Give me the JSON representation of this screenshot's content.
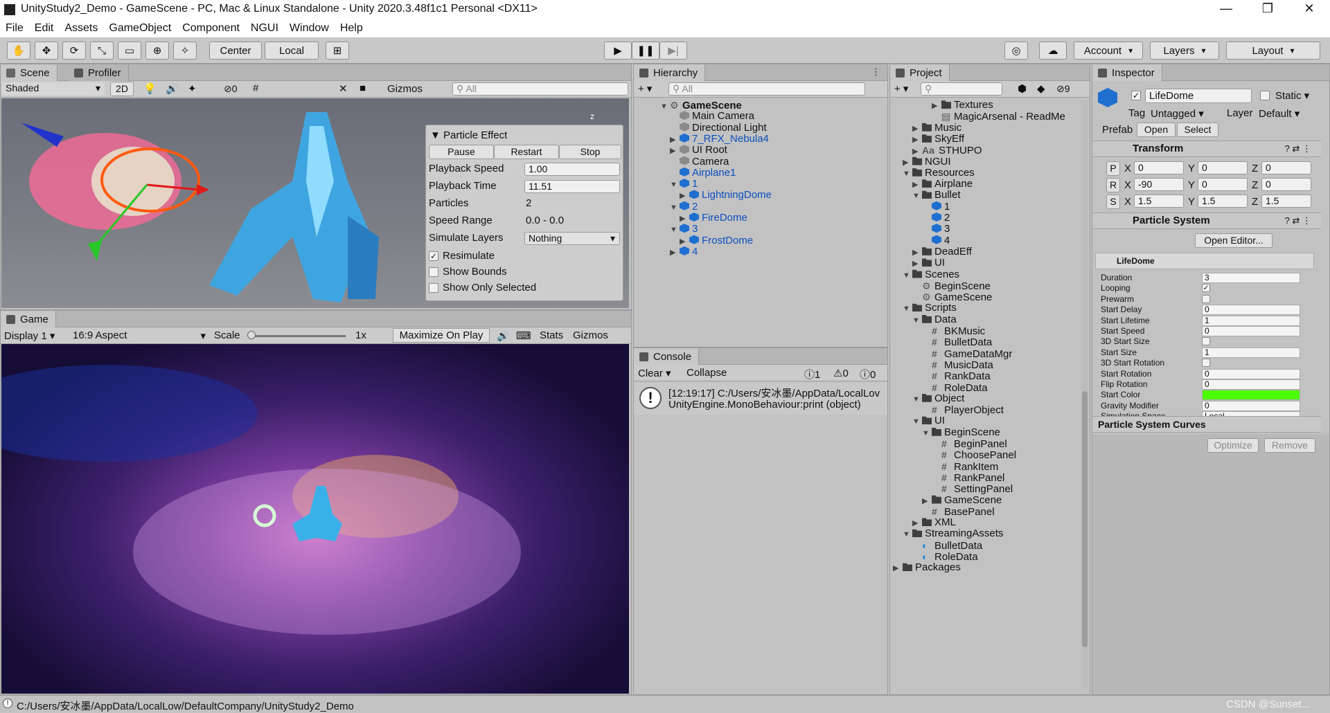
{
  "window": {
    "title": "UnityStudy2_Demo - GameScene - PC, Mac & Linux Standalone - Unity 2020.3.48f1c1 Personal <DX11>"
  },
  "menu": [
    "File",
    "Edit",
    "Assets",
    "GameObject",
    "Component",
    "NGUI",
    "Window",
    "Help"
  ],
  "toolbar": {
    "center": "Center",
    "local": "Local",
    "account": "Account",
    "layers": "Layers",
    "layout": "Layout"
  },
  "scene": {
    "tab": "Scene",
    "tab2": "Profiler",
    "shading": "Shaded",
    "mode2d": "2D",
    "fx_count": "0",
    "gizmos": "Gizmos",
    "search": "All",
    "axis": "z"
  },
  "particle_effect": {
    "title": "Particle Effect",
    "pause": "Pause",
    "restart": "Restart",
    "stop": "Stop",
    "labels": [
      "Playback Speed",
      "Playback Time",
      "Particles",
      "Speed Range",
      "Simulate Layers"
    ],
    "values": [
      "1.00",
      "11.51",
      "2",
      "0.0 - 0.0",
      "Nothing"
    ],
    "checks": [
      "Resimulate",
      "Show Bounds",
      "Show Only Selected"
    ],
    "check_states": [
      true,
      false,
      false
    ]
  },
  "game": {
    "tab": "Game",
    "display": "Display 1",
    "aspect": "16:9 Aspect",
    "scale_label": "Scale",
    "scale_value": "1x",
    "maximize": "Maximize On Play",
    "stats": "Stats",
    "gizmos": "Gizmos"
  },
  "hierarchy": {
    "tab": "Hierarchy",
    "search": "All",
    "items": [
      {
        "label": "GameScene",
        "indent": 0,
        "arrow": "▼",
        "icon": "scene",
        "style": "bold"
      },
      {
        "label": "Main Camera",
        "indent": 1,
        "arrow": "",
        "icon": "cubeg",
        "style": ""
      },
      {
        "label": "Directional Light",
        "indent": 1,
        "arrow": "",
        "icon": "cubeg",
        "style": ""
      },
      {
        "label": "7_RFX_Nebula4",
        "indent": 1,
        "arrow": "▶",
        "icon": "cube",
        "style": "blue"
      },
      {
        "label": "UI Root",
        "indent": 1,
        "arrow": "▶",
        "icon": "cubeg",
        "style": ""
      },
      {
        "label": "Camera",
        "indent": 1,
        "arrow": "",
        "icon": "cubeg",
        "style": ""
      },
      {
        "label": "Airplane1",
        "indent": 1,
        "arrow": "",
        "icon": "cube",
        "style": "blue"
      },
      {
        "label": "1",
        "indent": 1,
        "arrow": "▼",
        "icon": "cube",
        "style": "blue"
      },
      {
        "label": "LightningDome",
        "indent": 2,
        "arrow": "▶",
        "icon": "cube",
        "style": "blue"
      },
      {
        "label": "2",
        "indent": 1,
        "arrow": "▼",
        "icon": "cube",
        "style": "blue"
      },
      {
        "label": "FireDome",
        "indent": 2,
        "arrow": "▶",
        "icon": "cube",
        "style": "blue"
      },
      {
        "label": "3",
        "indent": 1,
        "arrow": "▼",
        "icon": "cube",
        "style": "blue"
      },
      {
        "label": "FrostDome",
        "indent": 2,
        "arrow": "▶",
        "icon": "cube",
        "style": "blue"
      },
      {
        "label": "4",
        "indent": 1,
        "arrow": "▶",
        "icon": "cube",
        "style": "blue"
      }
    ]
  },
  "console": {
    "tab": "Console",
    "clear": "Clear",
    "collapse": "Collapse",
    "count_log": "1",
    "count_warn": "0",
    "count_err": "0",
    "line1": "[12:19:17] C:/Users/安冰墨/AppData/LocalLov",
    "line2": "UnityEngine.MonoBehaviour:print (object)"
  },
  "project": {
    "tab": "Project",
    "hidden_count": "9",
    "items": [
      {
        "label": "Textures",
        "indent": 4,
        "arrow": "▶",
        "icon": "folder"
      },
      {
        "label": "MagicArsenal - ReadMe",
        "indent": 4,
        "arrow": "",
        "icon": "doc"
      },
      {
        "label": "Music",
        "indent": 2,
        "arrow": "▶",
        "icon": "folder"
      },
      {
        "label": "SkyEff",
        "indent": 2,
        "arrow": "▶",
        "icon": "folder"
      },
      {
        "label": "STHUPO",
        "indent": 2,
        "arrow": "▶",
        "icon": "font"
      },
      {
        "label": "NGUI",
        "indent": 1,
        "arrow": "▶",
        "icon": "folder"
      },
      {
        "label": "Resources",
        "indent": 1,
        "arrow": "▼",
        "icon": "folder"
      },
      {
        "label": "Airplane",
        "indent": 2,
        "arrow": "▶",
        "icon": "folder"
      },
      {
        "label": "Bullet",
        "indent": 2,
        "arrow": "▼",
        "icon": "folder"
      },
      {
        "label": "1",
        "indent": 3,
        "arrow": "",
        "icon": "cube"
      },
      {
        "label": "2",
        "indent": 3,
        "arrow": "",
        "icon": "cube"
      },
      {
        "label": "3",
        "indent": 3,
        "arrow": "",
        "icon": "cube"
      },
      {
        "label": "4",
        "indent": 3,
        "arrow": "",
        "icon": "cube"
      },
      {
        "label": "DeadEff",
        "indent": 2,
        "arrow": "▶",
        "icon": "folder"
      },
      {
        "label": "UI",
        "indent": 2,
        "arrow": "▶",
        "icon": "folder"
      },
      {
        "label": "Scenes",
        "indent": 1,
        "arrow": "▼",
        "icon": "folder"
      },
      {
        "label": "BeginScene",
        "indent": 2,
        "arrow": "",
        "icon": "scene"
      },
      {
        "label": "GameScene",
        "indent": 2,
        "arrow": "",
        "icon": "scene"
      },
      {
        "label": "Scripts",
        "indent": 1,
        "arrow": "▼",
        "icon": "folder"
      },
      {
        "label": "Data",
        "indent": 2,
        "arrow": "▼",
        "icon": "folder"
      },
      {
        "label": "BKMusic",
        "indent": 3,
        "arrow": "",
        "icon": "script"
      },
      {
        "label": "BulletData",
        "indent": 3,
        "arrow": "",
        "icon": "script"
      },
      {
        "label": "GameDataMgr",
        "indent": 3,
        "arrow": "",
        "icon": "script"
      },
      {
        "label": "MusicData",
        "indent": 3,
        "arrow": "",
        "icon": "script"
      },
      {
        "label": "RankData",
        "indent": 3,
        "arrow": "",
        "icon": "script"
      },
      {
        "label": "RoleData",
        "indent": 3,
        "arrow": "",
        "icon": "script"
      },
      {
        "label": "Object",
        "indent": 2,
        "arrow": "▼",
        "icon": "folder"
      },
      {
        "label": "PlayerObject",
        "indent": 3,
        "arrow": "",
        "icon": "script"
      },
      {
        "label": "UI",
        "indent": 2,
        "arrow": "▼",
        "icon": "folder"
      },
      {
        "label": "BeginScene",
        "indent": 3,
        "arrow": "▼",
        "icon": "folder"
      },
      {
        "label": "BeginPanel",
        "indent": 4,
        "arrow": "",
        "icon": "script"
      },
      {
        "label": "ChoosePanel",
        "indent": 4,
        "arrow": "",
        "icon": "script"
      },
      {
        "label": "RankItem",
        "indent": 4,
        "arrow": "",
        "icon": "script"
      },
      {
        "label": "RankPanel",
        "indent": 4,
        "arrow": "",
        "icon": "script"
      },
      {
        "label": "SettingPanel",
        "indent": 4,
        "arrow": "",
        "icon": "script"
      },
      {
        "label": "GameScene",
        "indent": 3,
        "arrow": "▶",
        "icon": "folder"
      },
      {
        "label": "BasePanel",
        "indent": 3,
        "arrow": "",
        "icon": "script"
      },
      {
        "label": "XML",
        "indent": 2,
        "arrow": "▶",
        "icon": "folder"
      },
      {
        "label": "StreamingAssets",
        "indent": 1,
        "arrow": "▼",
        "icon": "folder"
      },
      {
        "label": "BulletData",
        "indent": 2,
        "arrow": "",
        "icon": "edge"
      },
      {
        "label": "RoleData",
        "indent": 2,
        "arrow": "",
        "icon": "edge"
      },
      {
        "label": "Packages",
        "indent": 0,
        "arrow": "▶",
        "icon": "folder"
      }
    ]
  },
  "inspector": {
    "tab": "Inspector",
    "name": "LifeDome",
    "static": "Static",
    "tag_label": "Tag",
    "tag": "Untagged",
    "layer_label": "Layer",
    "layer": "Default",
    "prefab": "Prefab",
    "open": "Open",
    "select": "Select",
    "transform": {
      "title": "Transform",
      "rows": [
        {
          "l": "P",
          "x": "0",
          "y": "0",
          "z": "0"
        },
        {
          "l": "R",
          "x": "-90",
          "y": "0",
          "z": "0"
        },
        {
          "l": "S",
          "x": "1.5",
          "y": "1.5",
          "z": "1.5"
        }
      ]
    },
    "ps": {
      "title": "Particle System",
      "open_editor": "Open Editor...",
      "module": "LifeDome",
      "props": [
        {
          "l": "Duration",
          "v": "3"
        },
        {
          "l": "Looping",
          "v": "✓"
        },
        {
          "l": "Prewarm",
          "v": ""
        },
        {
          "l": "Start Delay",
          "v": "0"
        },
        {
          "l": "Start Lifetime",
          "v": "1"
        },
        {
          "l": "Start Speed",
          "v": "0"
        },
        {
          "l": "3D Start Size",
          "v": ""
        },
        {
          "l": "Start Size",
          "v": "1"
        },
        {
          "l": "3D Start Rotation",
          "v": ""
        },
        {
          "l": "Start Rotation",
          "v": "0"
        },
        {
          "l": "Flip Rotation",
          "v": "0"
        },
        {
          "l": "Start Color",
          "v": ""
        },
        {
          "l": "Gravity Modifier",
          "v": "0"
        },
        {
          "l": "Simulation Space",
          "v": "Local"
        }
      ]
    },
    "curves": {
      "title": "Particle System Curves",
      "optimize": "Optimize",
      "remove": "Remove"
    },
    "start_color": "#4bff00"
  },
  "status": {
    "path": "C:/Users/安冰墨/AppData/LocalLow/DefaultCompany/UnityStudy2_Demo",
    "watermark": "CSDN @Sunset..."
  }
}
